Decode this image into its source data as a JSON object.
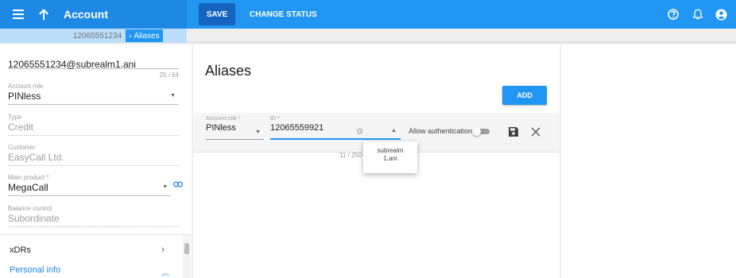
{
  "app": {
    "title": "Account"
  },
  "toolbar": {
    "save_label": "SAVE",
    "change_status_label": "CHANGE STATUS"
  },
  "breadcrumb": {
    "items": [
      "12065551234",
      "Aliases"
    ]
  },
  "left": {
    "main_field_value": "12065551234@subrealm1.ani",
    "main_field_counter": "25 / 64",
    "fields": [
      {
        "label": "Account role",
        "value": "PINless"
      },
      {
        "label": "Type",
        "value": "Credit"
      },
      {
        "label": "Customer",
        "value": "EasyCall Ltd."
      },
      {
        "label": "Main product *",
        "value": "MegaCall"
      },
      {
        "label": "Balance control",
        "value": "Subordinate"
      }
    ],
    "nav": [
      {
        "label": "xDRs",
        "color": "#212121"
      },
      {
        "label": "Personal info",
        "color": "#1e88e5"
      }
    ]
  },
  "main": {
    "title": "Aliases",
    "add_label": "ADD",
    "row": {
      "role_label": "Account role *",
      "role_value": "PINless",
      "id_label": "ID *",
      "id_value": "12065559921",
      "id_suffix": "@",
      "id_counter": "11 / 250",
      "allow_label": "Allow authentication"
    },
    "dropdown_option": "subrealm 1.ani"
  },
  "colors": {
    "primary": "#2196f3",
    "primary_dark": "#1565c0",
    "accent": "#1e88e5"
  }
}
